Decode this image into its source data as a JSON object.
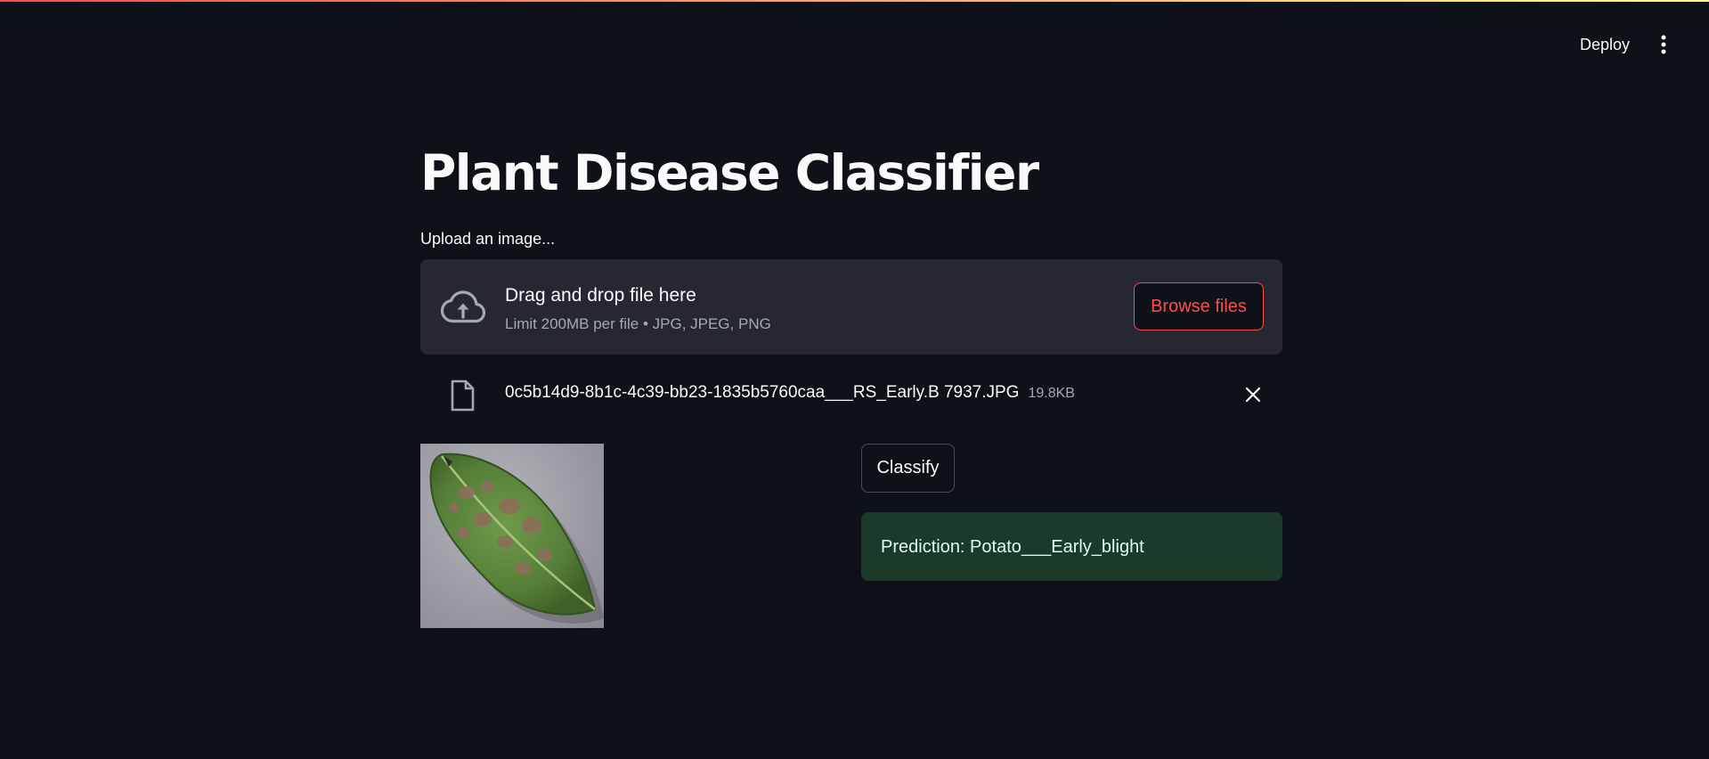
{
  "header": {
    "deploy_label": "Deploy",
    "menu_icon": "vertical-dots-icon"
  },
  "main": {
    "title": "Plant Disease Classifier",
    "uploader": {
      "label": "Upload an image...",
      "drop_title": "Drag and drop file here",
      "drop_subtitle": "Limit 200MB per file • JPG, JPEG, PNG",
      "browse_label": "Browse files",
      "icon": "cloud-upload-icon"
    },
    "uploaded_file": {
      "name": "0c5b14d9-8b1c-4c39-bb23-1835b5760caa___RS_Early.B 7937.JPG",
      "size": "19.8KB",
      "icon": "file-icon",
      "remove_icon": "close-icon"
    },
    "classify_label": "Classify",
    "prediction": "Prediction: Potato___Early_blight"
  },
  "colors": {
    "background": "#0e1117",
    "panel": "#262730",
    "accent": "#ff4b4b",
    "success_bg": "#1b3a2a",
    "success_text": "#dffde9"
  }
}
